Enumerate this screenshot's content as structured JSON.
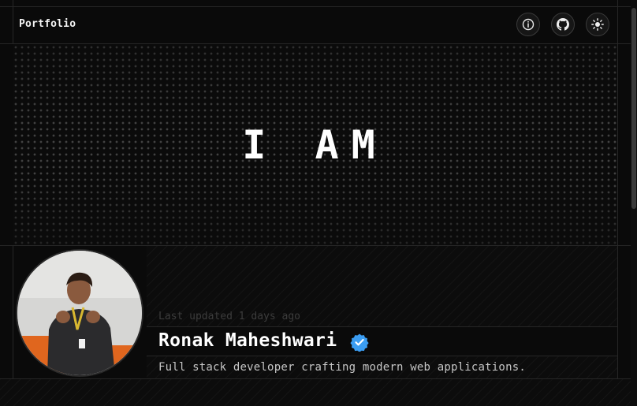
{
  "header": {
    "brand": "Portfolio",
    "buttons": [
      {
        "icon": "info-icon"
      },
      {
        "icon": "github-icon"
      },
      {
        "icon": "sun-icon"
      }
    ]
  },
  "hero": {
    "text": "I AM"
  },
  "profile": {
    "last_updated": "Last updated 1 days ago",
    "name": "Ronak Maheshwari",
    "verified_icon": "verified-badge-icon",
    "verified_color": "#3b9df2",
    "tagline": "Full stack developer crafting modern web applications."
  },
  "colors": {
    "background": "#0a0a0a",
    "border": "#262626",
    "text_primary": "#ffffff",
    "text_muted": "#3c3c3c"
  }
}
